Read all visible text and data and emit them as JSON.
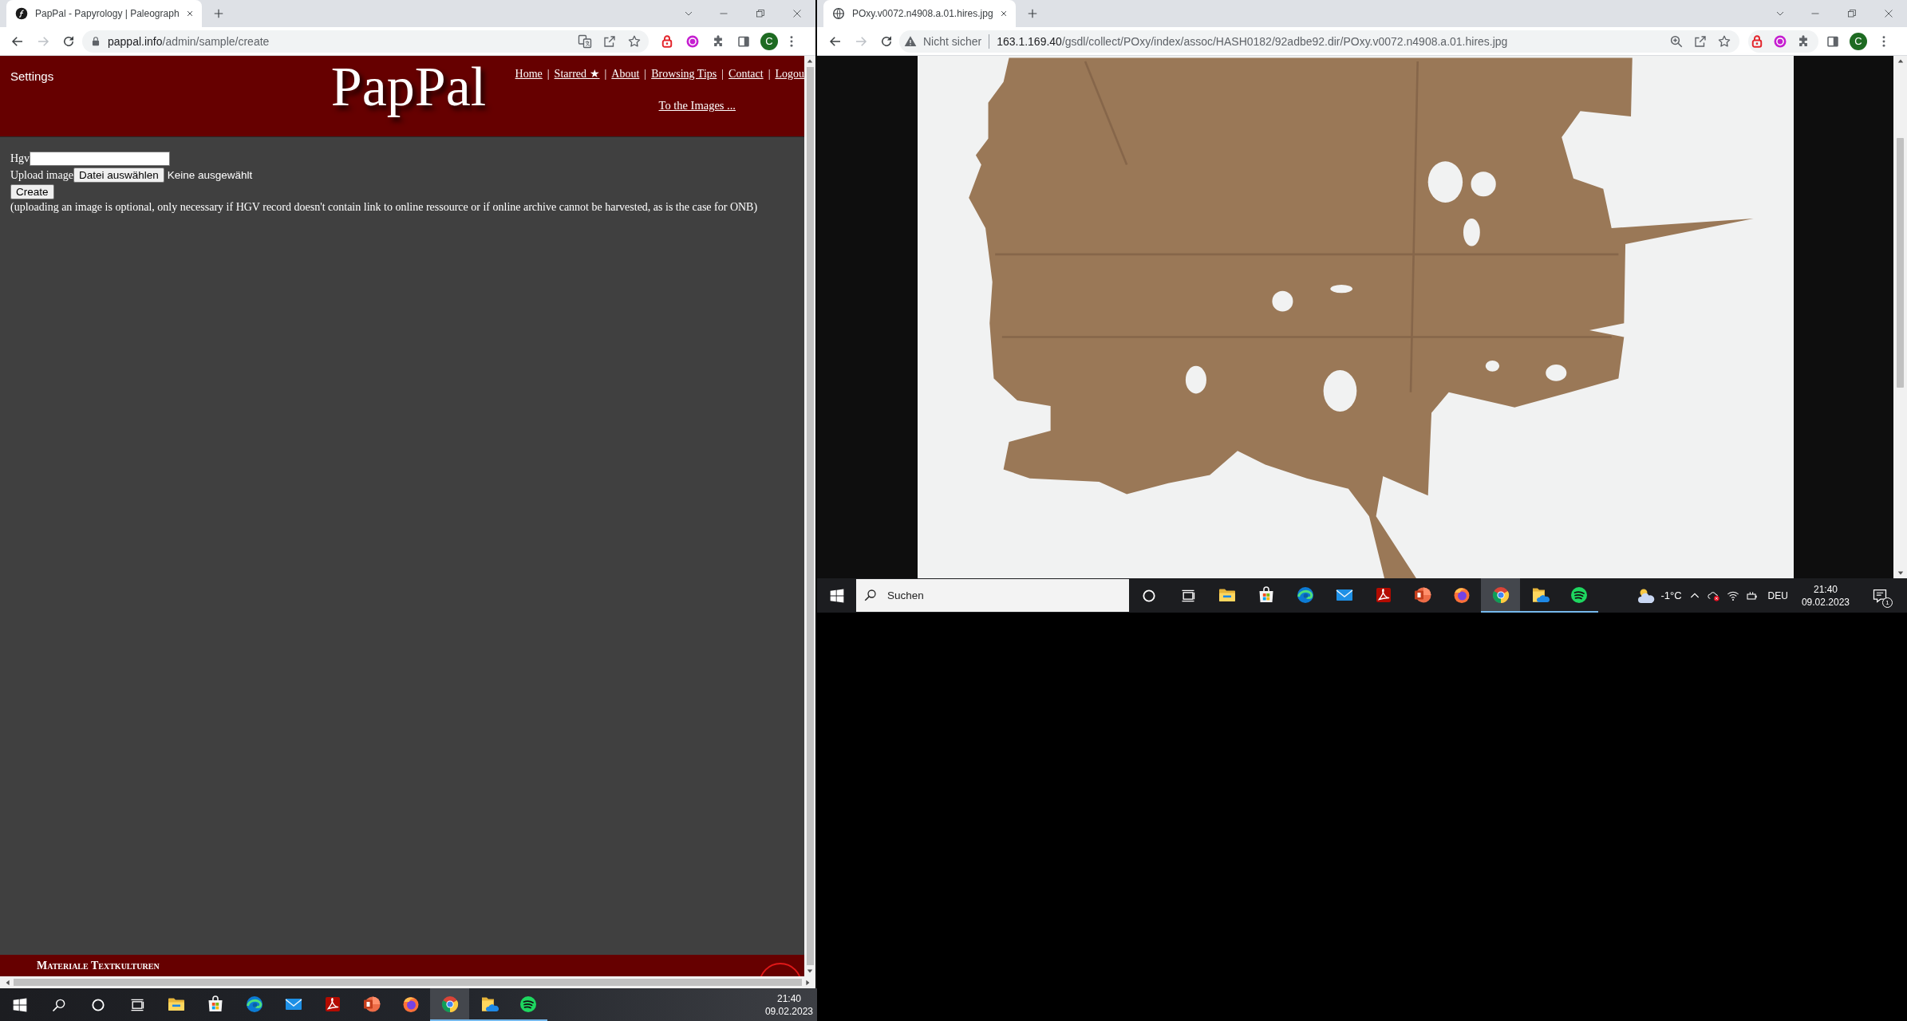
{
  "left_window": {
    "tab": {
      "title": "PapPal - Papyrology | Paleograph",
      "selected": true
    },
    "toolbar": {
      "back": {
        "disabled": false
      },
      "forward": {
        "disabled": true
      },
      "url_host": "pappal.info",
      "url_path": "/admin/sample/create",
      "profile_initial": "C"
    },
    "header": {
      "settings": "Settings",
      "logo": "PapPal",
      "nav": [
        {
          "label": "Home",
          "separator": "|"
        },
        {
          "label": "Starred ★",
          "separator": "|"
        },
        {
          "label": "About",
          "separator": "|"
        },
        {
          "label": "Browsing Tips",
          "separator": "|"
        },
        {
          "label": "Contact",
          "separator": "|"
        },
        {
          "label": "Logou"
        }
      ],
      "images_link": "To the Images ..."
    },
    "form": {
      "hgv_label": "Hgv",
      "upload_label": "Upload image",
      "file_button": "Datei auswählen",
      "file_status": "Keine ausgewählt",
      "create_button": "Create",
      "note": "(uploading an image is optional, only necessary if HGV record doesn't contain link to online ressource or if online archive cannot be harvested, as is the case for ONB)"
    },
    "footer": {
      "title": "Materiale Textkulturen"
    }
  },
  "left_taskbar": {
    "apps": [
      {
        "kind": "folder",
        "running": false,
        "selected": false
      },
      {
        "kind": "store",
        "running": false,
        "selected": false
      },
      {
        "kind": "swirl",
        "running": false,
        "selected": false
      },
      {
        "kind": "mail",
        "running": false,
        "selected": false
      },
      {
        "kind": "pdf",
        "running": false,
        "selected": false
      },
      {
        "kind": "slides",
        "running": false,
        "selected": false
      },
      {
        "kind": "foxglobe",
        "running": false,
        "selected": false
      },
      {
        "kind": "browser",
        "running": true,
        "selected": true
      },
      {
        "kind": "cloudfolder",
        "running": true,
        "selected": false
      },
      {
        "kind": "music",
        "running": true,
        "selected": false
      }
    ],
    "time": "21:40",
    "date": "09.02.2023"
  },
  "right_window": {
    "tab": {
      "title": "POxy.v0072.n4908.a.01.hires.jpg",
      "selected": true
    },
    "toolbar": {
      "back": {
        "disabled": false
      },
      "forward": {
        "disabled": true
      },
      "security_label": "Nicht sicher",
      "url_host": "163.1.169.40",
      "url_path": "/gsdl/collect/POxy/index/assoc/HASH0182/92adbe92.dir/POxy.v0072.n4908.a.01.hires.jpg",
      "profile_initial": "C"
    }
  },
  "right_taskbar": {
    "search": {
      "placeholder": "Suchen"
    },
    "apps": [
      {
        "kind": "folder",
        "running": false,
        "selected": false
      },
      {
        "kind": "store",
        "running": false,
        "selected": false
      },
      {
        "kind": "swirl",
        "running": false,
        "selected": false
      },
      {
        "kind": "mail",
        "running": false,
        "selected": false
      },
      {
        "kind": "pdf",
        "running": false,
        "selected": false
      },
      {
        "kind": "slides",
        "running": false,
        "selected": false
      },
      {
        "kind": "foxglobe",
        "running": false,
        "selected": false
      },
      {
        "kind": "browser",
        "running": true,
        "selected": true
      },
      {
        "kind": "cloudfolder",
        "running": true,
        "selected": false
      },
      {
        "kind": "music",
        "running": true,
        "selected": false
      }
    ],
    "temperature": "-1°C",
    "language": "DEU",
    "time": "21:40",
    "date": "09.02.2023",
    "notification_count": "1"
  }
}
